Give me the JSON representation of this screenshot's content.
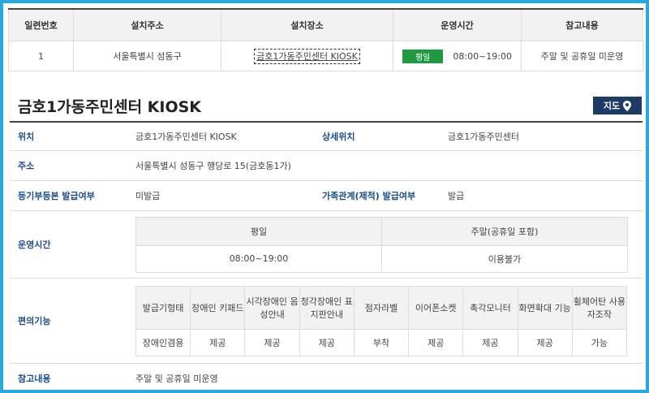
{
  "list_table": {
    "headers": [
      "일련번호",
      "설치주소",
      "설치장소",
      "운영시간",
      "참고내용"
    ],
    "row": {
      "serial": "1",
      "address": "서울특별시 성동구",
      "place": "금호1가동주민센터 KIOSK",
      "hours_badge": "평일",
      "hours": "08:00~19:00",
      "note": "주말 및 공휴일 미운영"
    }
  },
  "detail": {
    "title": "금호1가동주민센터 KIOSK",
    "map_button": "지도",
    "location_label": "위치",
    "location_value": "금호1가동주민센터 KIOSK",
    "sublocation_label": "상세위치",
    "sublocation_value": "금호1가동주민센터",
    "address_label": "주소",
    "address_value": "서울특별시 성동구 행당로 15(금호동1가)",
    "registry_label": "등기부등본 발급여부",
    "registry_value": "미발급",
    "family_label": "가족관계(제적) 발급여부",
    "family_value": "발급",
    "hours_label": "운영시간",
    "hours_table": {
      "headers": [
        "평일",
        "주말(공휴일 포함)"
      ],
      "values": [
        "08:00~19:00",
        "이용불가"
      ]
    },
    "convenience_label": "편의기능",
    "convenience_table": {
      "headers": [
        "발급기형태",
        "장애인 키패드",
        "시각장애인 음성안내",
        "청각장애인 표지판안내",
        "점자라벨",
        "이어폰소켓",
        "촉각모니터",
        "화면확대 기능",
        "휠체어탄 사용자조작"
      ],
      "values": [
        "장애인겸용",
        "제공",
        "제공",
        "제공",
        "부착",
        "제공",
        "제공",
        "제공",
        "가능"
      ]
    },
    "note_label": "참고내용",
    "note_value": "주말 및 공휴일 미운영"
  },
  "colors": {
    "frame": "#29a8e0",
    "badge": "#1f9a3f",
    "label": "#1a4e8a",
    "map_button": "#1e3a66"
  }
}
